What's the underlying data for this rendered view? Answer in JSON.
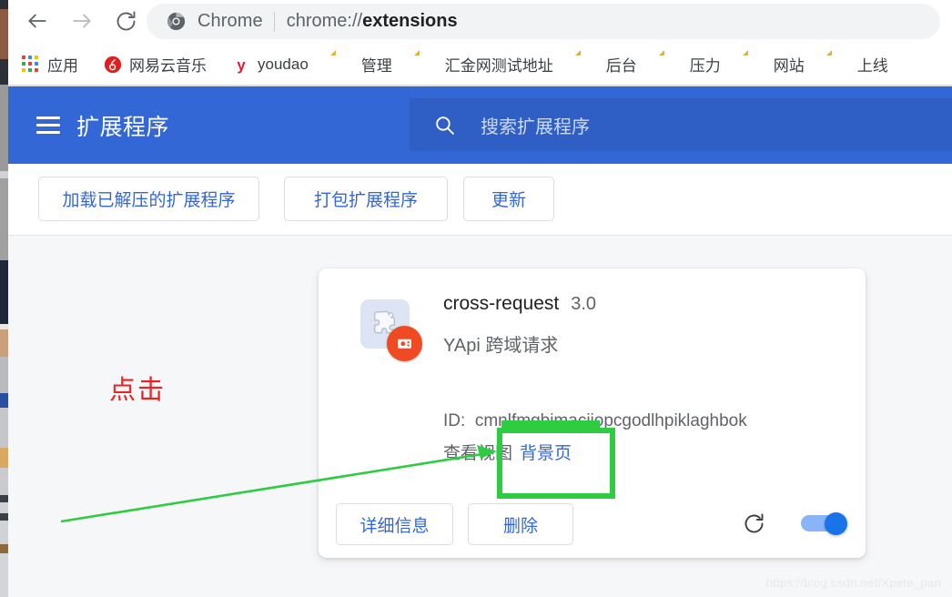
{
  "browser": {
    "nav": {
      "back_label": "back-arrow",
      "forward_label": "forward-arrow",
      "reload_label": "reload-arrow"
    },
    "omnibox": {
      "app_label": "Chrome",
      "url_prefix": "chrome://",
      "url_bold": "extensions"
    },
    "bookmarks": [
      {
        "label": "应用",
        "icon": "apps-grid-icon",
        "type": "apps"
      },
      {
        "label": "网易云音乐",
        "icon": "netease-music-icon",
        "type": "netease"
      },
      {
        "label": "youdao",
        "icon": "youdao-icon",
        "type": "youdao"
      },
      {
        "label": "管理",
        "icon": "folder-icon",
        "type": "folder"
      },
      {
        "label": "汇金网测试地址",
        "icon": "folder-icon",
        "type": "folder"
      },
      {
        "label": "后台",
        "icon": "folder-icon",
        "type": "folder"
      },
      {
        "label": "压力",
        "icon": "folder-icon",
        "type": "folder"
      },
      {
        "label": "网站",
        "icon": "folder-icon",
        "type": "folder"
      },
      {
        "label": "上线",
        "icon": "folder-icon",
        "type": "folder"
      }
    ]
  },
  "extensions_page": {
    "header": {
      "menu_icon": "hamburger-menu-icon",
      "title": "扩展程序",
      "search_icon": "search-icon",
      "search_placeholder": "搜索扩展程序",
      "search_value": ""
    },
    "toolbar": {
      "load_unpacked": "加载已解压的扩展程序",
      "pack_extension": "打包扩展程序",
      "update": "更新"
    },
    "card": {
      "icon": "puzzle-piece-icon",
      "badge_icon": "camera-badge-icon",
      "name": "cross-request",
      "version": "3.0",
      "description": "YApi 跨域请求",
      "id_label": "ID:",
      "id_value": "cmnlfmgbjmaciiopcgodlhpiklaghbok",
      "views_label": "查看视图",
      "views_link": "背景页",
      "details_button": "详细信息",
      "remove_button": "删除",
      "reload_icon": "reload-icon",
      "enabled_toggle": "toggle-on"
    }
  },
  "annotations": {
    "click_text": "点击",
    "arrow_color": "#2ecc40",
    "box_color": "#2ecc40",
    "click_color": "#f02020"
  },
  "watermark": "https://blog.csdn.net/Xpete_pan",
  "colors": {
    "header_blue": "#3367d6",
    "search_blue": "#2f5fc4",
    "link_blue": "#3367d6",
    "toggle_on": "#1a73e8",
    "page_bg": "#f6f7f9"
  }
}
